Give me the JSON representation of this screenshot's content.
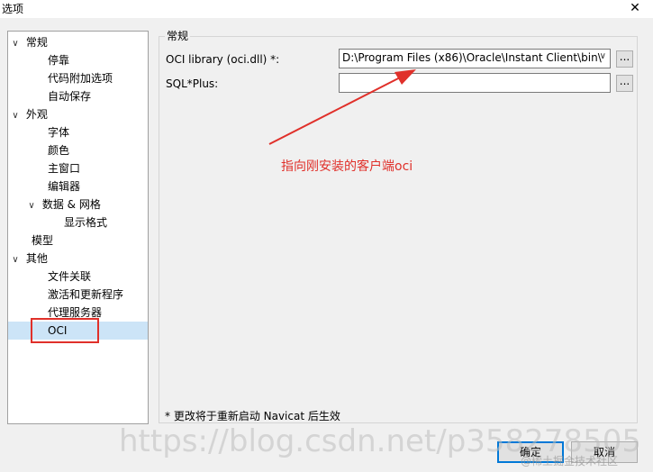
{
  "window": {
    "title": "选项",
    "close_glyph": "✕"
  },
  "tree": {
    "items": [
      {
        "label": "常规",
        "expanded": true
      },
      {
        "label": "停靠"
      },
      {
        "label": "代码附加选项"
      },
      {
        "label": "自动保存"
      },
      {
        "label": "外观",
        "expanded": true
      },
      {
        "label": "字体"
      },
      {
        "label": "颜色"
      },
      {
        "label": "主窗口"
      },
      {
        "label": "编辑器"
      },
      {
        "label": "数据 & 网格",
        "expanded": true
      },
      {
        "label": "显示格式"
      },
      {
        "label": "模型"
      },
      {
        "label": "其他",
        "expanded": true
      },
      {
        "label": "文件关联"
      },
      {
        "label": "激活和更新程序"
      },
      {
        "label": "代理服务器"
      },
      {
        "label": "OCI",
        "selected": true
      }
    ],
    "chevron_glyph": "∨"
  },
  "panel": {
    "group_title": "常规",
    "oci_label": "OCI library (oci.dll) *:",
    "oci_value": "D:\\Program Files (x86)\\Oracle\\Instant Client\\bin\\",
    "sqlplus_label": "SQL*Plus:",
    "sqlplus_value": "",
    "browse_label": "...",
    "footnote": "* 更改将于重新启动 Navicat 后生效"
  },
  "annotation": {
    "text": "指向刚安装的客户端oci",
    "color": "#e0302a"
  },
  "buttons": {
    "ok": "确定",
    "cancel": "取消"
  },
  "watermark": {
    "text": "https://blog.csdn.net/p358278505",
    "juejin": "@稀土掘金技术社区"
  }
}
